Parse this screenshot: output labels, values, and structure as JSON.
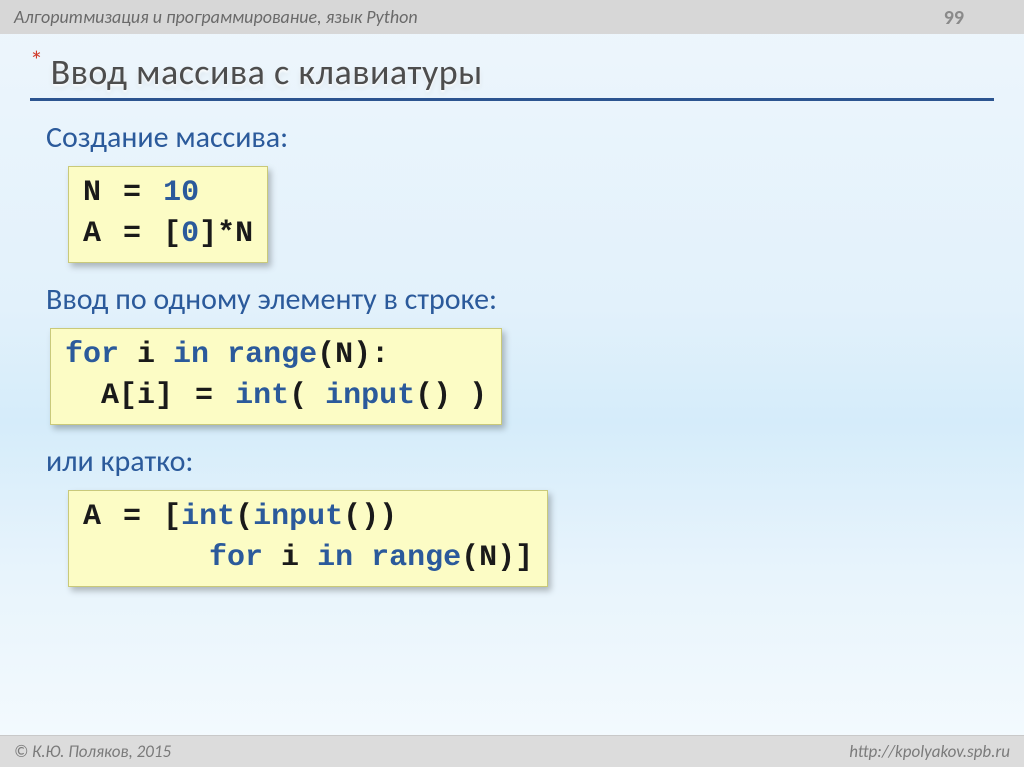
{
  "header": {
    "course": "Алгоритмизация и программирование, язык Python",
    "page": "99"
  },
  "slide": {
    "bullet": "*",
    "title": "Ввод массива с клавиатуры",
    "line1": "Создание массива:",
    "line2": "Ввод по одному элементу в строке:",
    "line3": "или кратко:"
  },
  "code1": {
    "l1a": "N",
    "l1eq": "=",
    "l1b": "10",
    "l2a": "A",
    "l2eq": "=",
    "l2b": "[",
    "l2c": "0",
    "l2d": "]*N"
  },
  "code2": {
    "l1a": "for",
    "l1b": " i ",
    "l1c": "in",
    "l1d": " ",
    "l1e": "range",
    "l1f": "(N):",
    "l2pad": "  ",
    "l2a": "A[i]",
    "l2eq": "=",
    "l2b": "int",
    "l2c": "( ",
    "l2d": "input",
    "l2e": "() )"
  },
  "code3": {
    "l1a": "A",
    "l1eq": "=",
    "l1b": "[",
    "l1c": "int",
    "l1d": "(",
    "l1e": "input",
    "l1f": "())",
    "l2pad": "       ",
    "l2a": "for",
    "l2b": " i ",
    "l2c": "in",
    "l2d": " ",
    "l2e": "range",
    "l2f": "(N)]"
  },
  "footer": {
    "copyright": "© К.Ю. Поляков, 2015",
    "url": "http://kpolyakov.spb.ru"
  }
}
